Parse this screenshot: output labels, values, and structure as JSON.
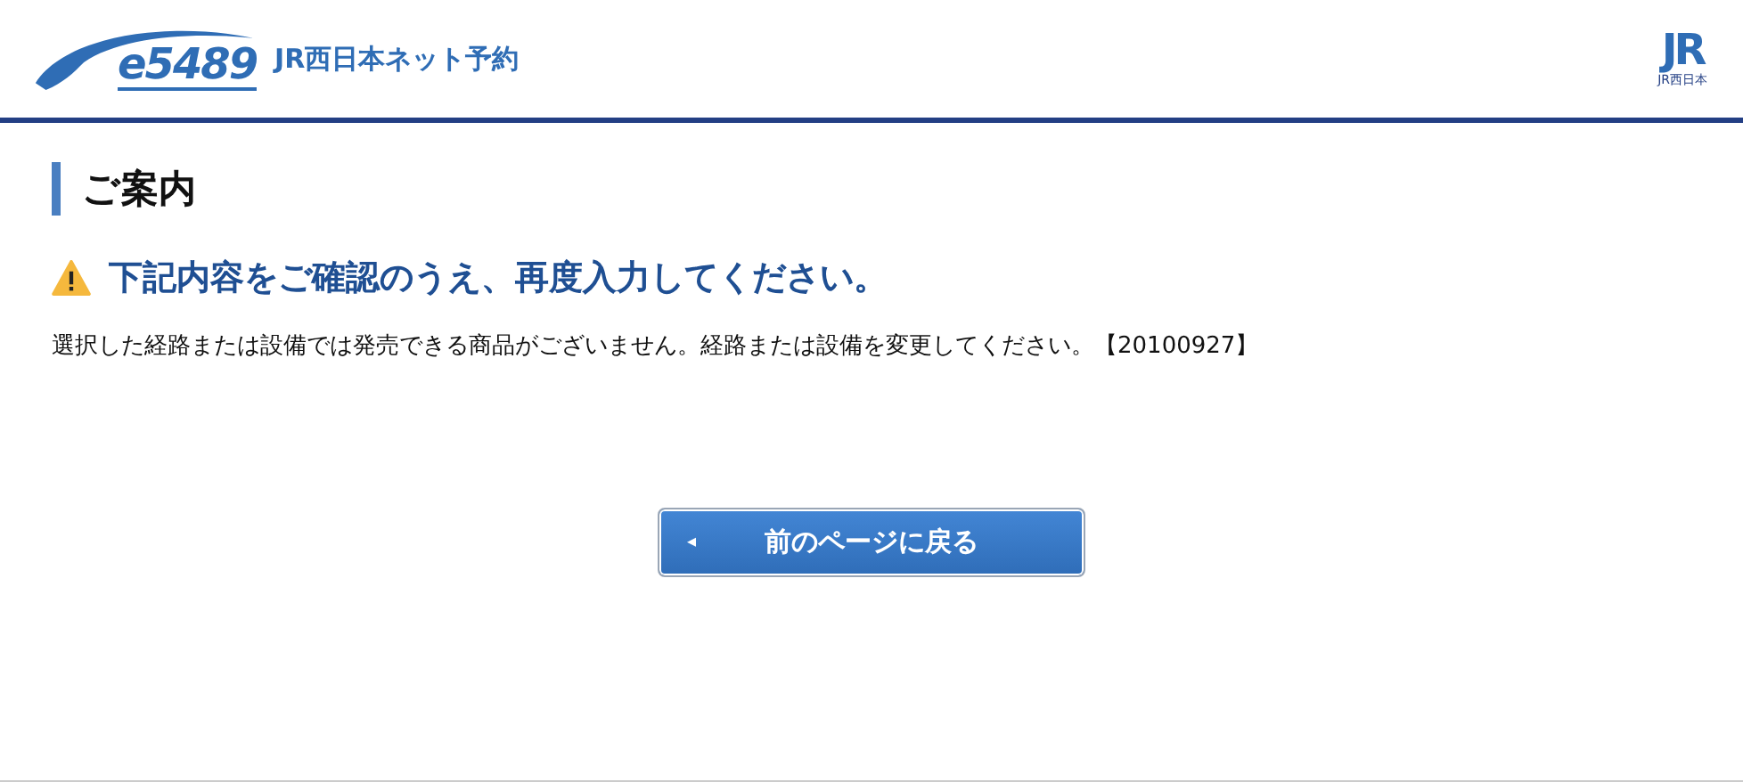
{
  "header": {
    "logo_text": "e5489",
    "service_name": "JR西日本ネット予約",
    "company_logo": "JR",
    "company_name": "JR西日本"
  },
  "page_title": "ご案内",
  "warning": "下記内容をご確認のうえ、再度入力してください。",
  "message": "選択した経路または設備では発売できる商品がございません。経路または設備を変更してください。【20100927】",
  "back_button": {
    "icon": "◂",
    "label": "前のページに戻る"
  }
}
